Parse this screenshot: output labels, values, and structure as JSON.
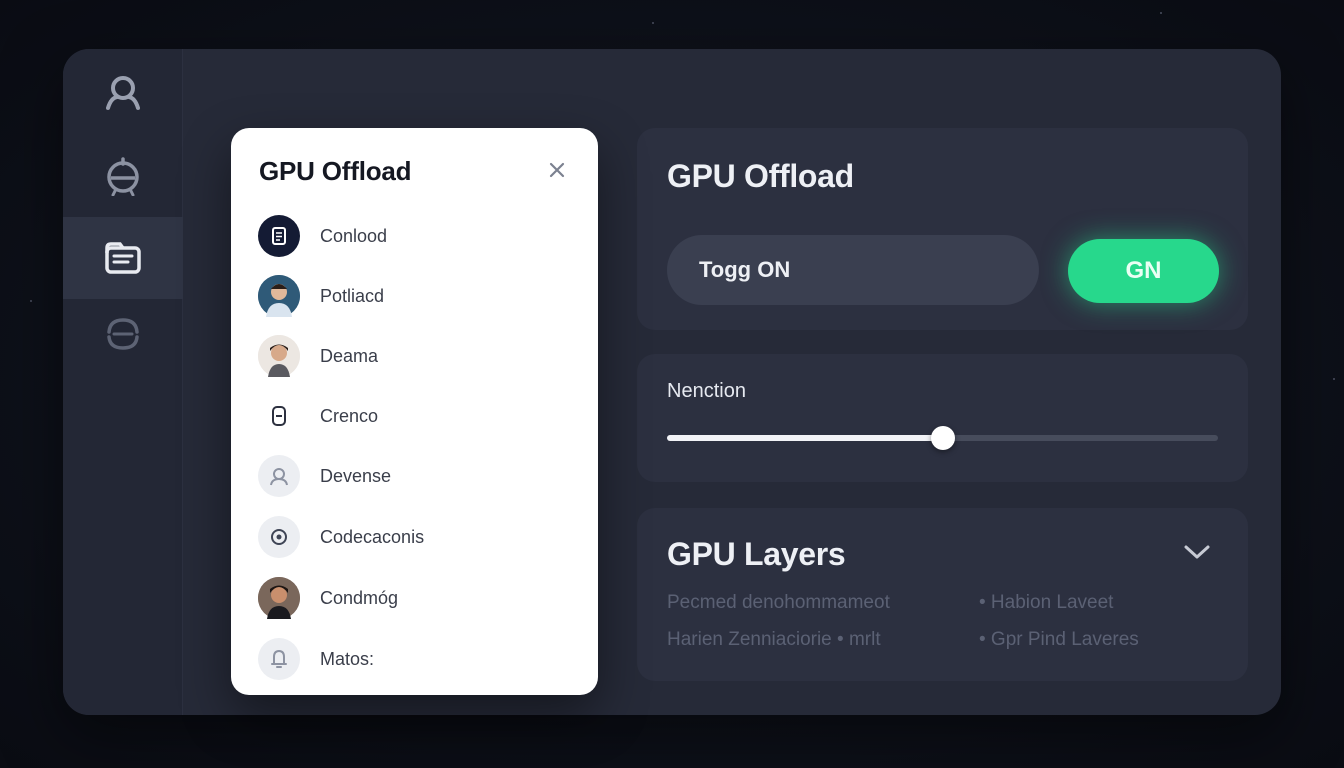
{
  "sidebar": {
    "items": [
      {
        "icon": "user-icon",
        "active": false
      },
      {
        "icon": "helmet-icon",
        "active": false
      },
      {
        "icon": "folder-icon",
        "active": true
      },
      {
        "icon": "swirl-icon",
        "active": false
      }
    ]
  },
  "dialog": {
    "title": "GPU Offload",
    "close_icon": "close-icon",
    "items": [
      {
        "label": "Conlood",
        "icon": "document-icon"
      },
      {
        "label": "Potliacd",
        "icon": "avatar"
      },
      {
        "label": "Deama",
        "icon": "avatar"
      },
      {
        "label": "Crenco",
        "icon": "battery-icon"
      },
      {
        "label": "Devense",
        "icon": "user-icon"
      },
      {
        "label": "Codecaconis",
        "icon": "target-icon"
      },
      {
        "label": "Condmóg",
        "icon": "avatar"
      },
      {
        "label": "Matos:",
        "icon": "bell-icon"
      }
    ]
  },
  "offload_card": {
    "title": "GPU Offload",
    "toggle_text": "Togg ON",
    "button_label": "GN"
  },
  "slider_card": {
    "label": "Nenction",
    "value_fraction": 0.5
  },
  "layers_card": {
    "title": "GPU Layers",
    "lines": [
      {
        "left": "Pecmed denohommameot",
        "right": "• Habion Laveet"
      },
      {
        "left": "Harien Zenniaciorie  •  mrlt",
        "right": "• Gpr Pind Laveres"
      }
    ]
  },
  "colors": {
    "window_bg": "#262a38",
    "accent_green": "#27d88c",
    "card_bg": "#2c3040",
    "dialog_bg": "#ffffff"
  }
}
